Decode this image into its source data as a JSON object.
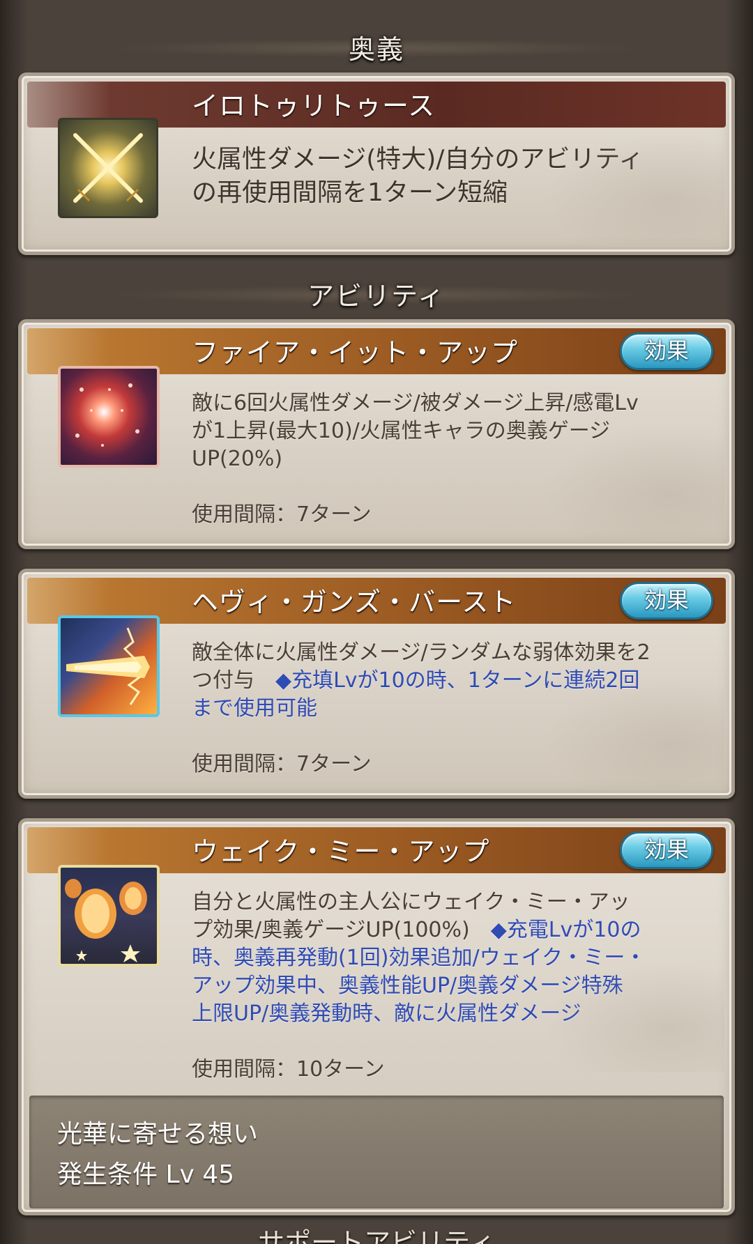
{
  "sections": {
    "ougi_title": "奥義",
    "ability_title": "アビリティ",
    "support_title_partial": "サポートアビリティ"
  },
  "ougi": {
    "name": "イロトゥリトゥース",
    "icon": "crossed-swords-icon",
    "description_line1": "火属性ダメージ(特大)/自分のアビリティ",
    "description_line2": "の再使用間隔を1ターン短縮"
  },
  "abilities": [
    {
      "name": "ファイア・イット・アップ",
      "icon": "fireworks-icon",
      "effect_label": "効果",
      "description_lines": [
        "敵に6回火属性ダメージ/被ダメージ上昇/感電Lv",
        "が1上昇(最大10)/火属性キャラの奥義ゲージ",
        "UP(20%)"
      ],
      "cooldown": "使用間隔：7ターン"
    },
    {
      "name": "ヘヴィ・ガンズ・バースト",
      "icon": "gun-blast-icon",
      "effect_label": "効果",
      "description_line1": "敵全体に火属性ダメージ/ランダムな弱体効果を2",
      "description_line2_normal": "つ付与　",
      "description_line2_blue": "◆充填Lvが10の時、1ターンに連続2回",
      "description_line3_blue": "まで使用可能",
      "cooldown": "使用間隔：7ターン"
    },
    {
      "name": "ウェイク・ミー・アップ",
      "icon": "lanterns-icon",
      "effect_label": "効果",
      "description_line1": "自分と火属性の主人公にウェイク・ミー・アッ",
      "description_line2_normal": "プ効果/奥義ゲージUP(100%)　",
      "description_line2_blue": "◆充電Lvが10の",
      "description_line3_blue": "時、奥義再発動(1回)効果追加/ウェイク・ミー・",
      "description_line4_blue": "アップ効果中、奥義性能UP/奥義ダメージ特殊",
      "description_line5_blue": "上限UP/奥義発動時、敵に火属性ダメージ",
      "cooldown": "使用間隔：10ターン"
    }
  ],
  "unlock_panel": {
    "title": "光華に寄せる想い",
    "condition": "発生条件 Lv 45"
  }
}
